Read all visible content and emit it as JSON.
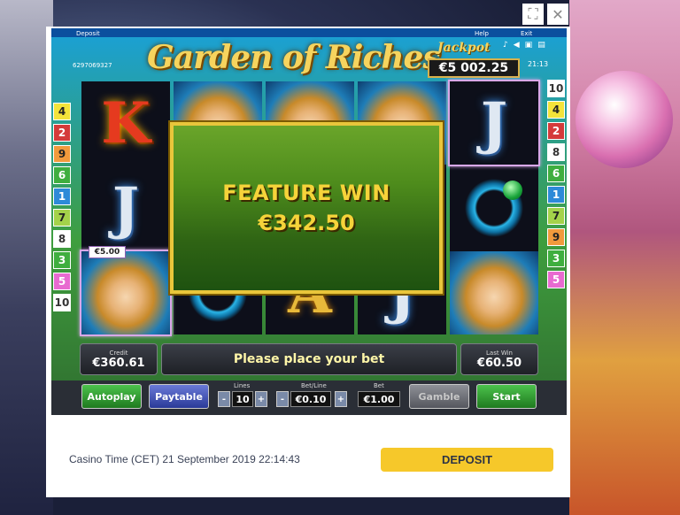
{
  "window": {
    "fullscreen_icon": "expand-icon",
    "close_icon": "close-icon"
  },
  "game": {
    "top_left": {
      "deposit_label": "Deposit",
      "account_id": "6297069327"
    },
    "top_right": {
      "help_label": "Help",
      "exit_label": "Exit",
      "clock": "21:13"
    },
    "title": "Garden of Riches",
    "jackpot": {
      "label": "Jackpot",
      "value": "€5 002.25"
    },
    "reels": [
      [
        "K",
        "J",
        "lady"
      ],
      [
        "lady",
        "",
        "ring"
      ],
      [
        "lady",
        "",
        "A"
      ],
      [
        "lady",
        "",
        "J"
      ],
      [
        "J",
        "ring",
        "lady"
      ]
    ],
    "left_lines": [
      "4",
      "2",
      "9",
      "6",
      "1",
      "7",
      "8",
      "3",
      "5",
      "10"
    ],
    "right_lines": [
      "10",
      "4",
      "2",
      "8",
      "6",
      "1",
      "7",
      "9",
      "3",
      "5"
    ],
    "line_win_tag": "€5.00",
    "feature": {
      "title": "FEATURE WIN",
      "amount": "€342.50"
    },
    "credit": {
      "label": "Credit",
      "value": "€360.61"
    },
    "message": "Please place your bet",
    "last_win": {
      "label": "Last Win",
      "value": "€60.50"
    },
    "controls": {
      "autoplay": "Autoplay",
      "paytable": "Paytable",
      "lines_label": "Lines",
      "lines_value": "10",
      "bet_line_label": "Bet/Line",
      "bet_line_value": "€0.10",
      "bet_label": "Bet",
      "bet_value": "€1.00",
      "gamble": "Gamble",
      "start": "Start",
      "minus": "-",
      "plus": "+"
    }
  },
  "footer": {
    "casino_time": "Casino Time (CET) 21 September 2019 22:14:43",
    "deposit_button": "DEPOSIT"
  },
  "colors": {
    "accent_gold": "#f6d33a",
    "deposit_yellow": "#f6c82a",
    "start_green": "#1f7a1f"
  }
}
